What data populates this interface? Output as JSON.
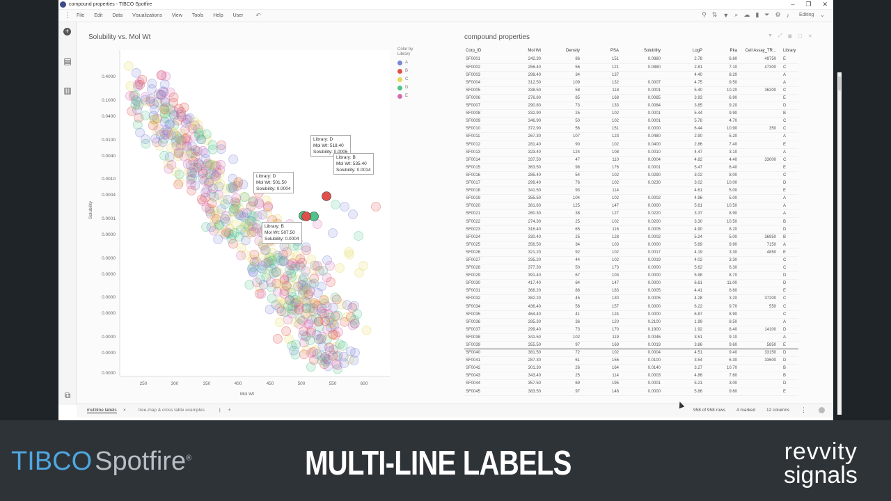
{
  "window": {
    "title": "compound properties - TIBCO Spotfire",
    "controls": [
      "–",
      "❐",
      "✕"
    ]
  },
  "menu": {
    "items": [
      "File",
      "Edit",
      "Data",
      "Visualizations",
      "View",
      "Tools",
      "Help",
      "User"
    ],
    "mode": "Editing"
  },
  "scatter": {
    "title": "Solubility vs. Mol Wt",
    "xlabel": "Mol Wt",
    "ylabel": "Solubility",
    "yticks": [
      "0.4000",
      "0.1000",
      "0.0400",
      "0.0100",
      "0.0040",
      "0.0010",
      "0.0004",
      "0.0001",
      "0.0000",
      "0.0000",
      "0.0000",
      "0.0000",
      "0.0000",
      "0.0000",
      "0.0000",
      "0.0000",
      "0.0000",
      "0.0000"
    ],
    "xticks": [
      "250",
      "300",
      "350",
      "400",
      "450",
      "500",
      "550",
      "600"
    ],
    "legend_title": "Color by",
    "legend_sub": "Library",
    "legend": [
      {
        "label": "A",
        "color": "#7b86d6"
      },
      {
        "label": "B",
        "color": "#e0504a"
      },
      {
        "label": "C",
        "color": "#e6d95a"
      },
      {
        "label": "D",
        "color": "#4fc48a"
      },
      {
        "label": "E",
        "color": "#d46bb4"
      }
    ],
    "tooltips": [
      {
        "lines": [
          "Library: D",
          "Mol Wt: 518.40",
          "Solubility: 0.0006"
        ]
      },
      {
        "lines": [
          "Library: B",
          "Mol Wt: 535.40",
          "Solubility: 0.0014"
        ]
      },
      {
        "lines": [
          "Library: D",
          "Mol Wt: 501.50",
          "Solubility: 0.0004"
        ]
      },
      {
        "lines": [
          "Library: B",
          "Mol Wt: 507.50",
          "Solubility: 0.0004"
        ]
      }
    ]
  },
  "table": {
    "title": "compound properties",
    "columns": [
      "Corp_ID",
      "Mol Wt",
      "Density",
      "PSA",
      "Solubility",
      "LogP",
      "Pka",
      "Cell Assay_TR...",
      "Library"
    ],
    "rows": [
      [
        "SF0001",
        "242.30",
        "86",
        "151",
        "0.0880",
        "2.78",
        "6.60",
        "49750",
        "E"
      ],
      [
        "SF0002",
        "256.40",
        "56",
        "121",
        "0.0880",
        "2.81",
        "7.10",
        "47300",
        "C"
      ],
      [
        "SF0003",
        "298.40",
        "34",
        "137",
        "",
        "4.40",
        "8.20",
        "",
        "A"
      ],
      [
        "SF0004",
        "312.50",
        "109",
        "132",
        "0.0007",
        "4.75",
        "9.50",
        "",
        "A"
      ],
      [
        "SF0005",
        "338.50",
        "58",
        "118",
        "0.0001",
        "5.40",
        "10.20",
        "36200",
        "C"
      ],
      [
        "SF0006",
        "276.80",
        "85",
        "168",
        "0.0085",
        "3.93",
        "6.90",
        "",
        "E"
      ],
      [
        "SF0007",
        "290.80",
        "73",
        "133",
        "0.0084",
        "3.85",
        "9.20",
        "",
        "D"
      ],
      [
        "SF0008",
        "332.90",
        "25",
        "102",
        "0.0001",
        "5.44",
        "9.90",
        "",
        "B"
      ],
      [
        "SF0009",
        "346.90",
        "50",
        "102",
        "0.0001",
        "5.78",
        "4.70",
        "",
        "C"
      ],
      [
        "SF0010",
        "372.90",
        "56",
        "151",
        "0.0000",
        "6.44",
        "10.90",
        "350",
        "C"
      ],
      [
        "SF0011",
        "267.30",
        "107",
        "123",
        "0.0480",
        "2.90",
        "5.20",
        "",
        "A"
      ],
      [
        "SF0012",
        "281.40",
        "90",
        "102",
        "0.0400",
        "2.86",
        "7.40",
        "",
        "E"
      ],
      [
        "SF0013",
        "323.40",
        "124",
        "108",
        "0.0010",
        "4.47",
        "3.10",
        "",
        "A"
      ],
      [
        "SF0014",
        "337.50",
        "47",
        "110",
        "0.0004",
        "4.82",
        "4.40",
        "33000",
        "C"
      ],
      [
        "SF0015",
        "363.50",
        "98",
        "176",
        "0.0001",
        "5.47",
        "6.40",
        "",
        "E"
      ],
      [
        "SF0016",
        "285.40",
        "54",
        "102",
        "0.0290",
        "3.02",
        "8.00",
        "",
        "C"
      ],
      [
        "SF0017",
        "299.40",
        "76",
        "102",
        "0.0230",
        "3.02",
        "10.00",
        "",
        "D"
      ],
      [
        "SF0018",
        "341.50",
        "93",
        "114",
        "",
        "4.61",
        "5.00",
        "",
        "E"
      ],
      [
        "SF0019",
        "355.50",
        "104",
        "102",
        "0.0002",
        "4.96",
        "5.00",
        "",
        "A"
      ],
      [
        "SF0020",
        "381.60",
        "125",
        "147",
        "0.0000",
        "5.61",
        "10.50",
        "",
        "A"
      ],
      [
        "SF0021",
        "260.30",
        "38",
        "127",
        "0.0220",
        "3.37",
        "8.90",
        "",
        "A"
      ],
      [
        "SF0022",
        "274.30",
        "25",
        "102",
        "0.0200",
        "3.30",
        "10.50",
        "",
        "B"
      ],
      [
        "SF0023",
        "316.40",
        "65",
        "116",
        "0.0005",
        "4.90",
        "8.20",
        "",
        "D"
      ],
      [
        "SF0024",
        "330.40",
        "25",
        "128",
        "0.0002",
        "5.24",
        "5.00",
        "36950",
        "B"
      ],
      [
        "SF0025",
        "356.50",
        "34",
        "103",
        "0.0000",
        "5.89",
        "9.90",
        "7150",
        "A"
      ],
      [
        "SF0026",
        "321.20",
        "92",
        "102",
        "0.0017",
        "4.19",
        "3.30",
        "4850",
        "E"
      ],
      [
        "SF0027",
        "335.20",
        "44",
        "102",
        "0.0019",
        "4.02",
        "3.30",
        "",
        "C"
      ],
      [
        "SF0028",
        "377.30",
        "50",
        "173",
        "0.0000",
        "5.62",
        "6.30",
        "",
        "C"
      ],
      [
        "SF0029",
        "391.40",
        "67",
        "103",
        "0.0000",
        "5.98",
        "8.70",
        "",
        "D"
      ],
      [
        "SF0030",
        "417.40",
        "64",
        "147",
        "0.0000",
        "6.61",
        "11.00",
        "",
        "D"
      ],
      [
        "SF0031",
        "368.20",
        "88",
        "183",
        "0.0005",
        "4.41",
        "6.60",
        "",
        "E"
      ],
      [
        "SF0032",
        "382.20",
        "45",
        "130",
        "0.0005",
        "4.28",
        "3.20",
        "37200",
        "C"
      ],
      [
        "SF0034",
        "436.40",
        "56",
        "157",
        "0.0000",
        "6.22",
        "9.70",
        "550",
        "C"
      ],
      [
        "SF0035",
        "464.40",
        "41",
        "124",
        "0.0000",
        "6.87",
        "8.90",
        "",
        "C"
      ],
      [
        "SF0036",
        "285.30",
        "36",
        "120",
        "0.2100",
        "1.99",
        "8.50",
        "",
        "A"
      ],
      [
        "SF0037",
        "299.40",
        "73",
        "170",
        "0.1900",
        "1.92",
        "8.40",
        "14100",
        "D"
      ],
      [
        "SF0038",
        "341.50",
        "102",
        "119",
        "0.0046",
        "3.51",
        "9.10",
        "",
        "A"
      ],
      [
        "SF0039",
        "355.50",
        "97",
        "169",
        "0.0019",
        "3.86",
        "9.60",
        "5850",
        "E"
      ],
      [
        "SF0040",
        "381.50",
        "72",
        "102",
        "0.0004",
        "4.51",
        "9.40",
        "33150",
        "D"
      ],
      [
        "SF0041",
        "287.30",
        "61",
        "156",
        "0.0100",
        "3.54",
        "6.30",
        "33600",
        "D"
      ],
      [
        "SF0042",
        "301.30",
        "26",
        "164",
        "0.0140",
        "3.27",
        "10.70",
        "",
        "B"
      ],
      [
        "SF0043",
        "343.40",
        "25",
        "114",
        "0.0003",
        "4.86",
        "7.60",
        "",
        "B"
      ],
      [
        "SF0044",
        "357.50",
        "69",
        "195",
        "0.0001",
        "5.21",
        "3.00",
        "",
        "D"
      ],
      [
        "SF0045",
        "383.50",
        "97",
        "148",
        "0.0000",
        "5.86",
        "9.60",
        "",
        "E"
      ]
    ]
  },
  "status": {
    "tab1": "multiline labels",
    "tab2": "tree-map & cross table examples",
    "add_tab": "+",
    "close": "×",
    "rows": "958 of 958 rows",
    "marked": "4 marked",
    "columns": "12 columns",
    "more": "⋮"
  },
  "footer": {
    "brand1": "TIBC",
    "brand1_o": "O",
    "brand2": "Spotfire",
    "reg": "®",
    "headline": "MULTI-LINE LABELS",
    "logo_line1": "revvity",
    "logo_line2": "signals"
  }
}
